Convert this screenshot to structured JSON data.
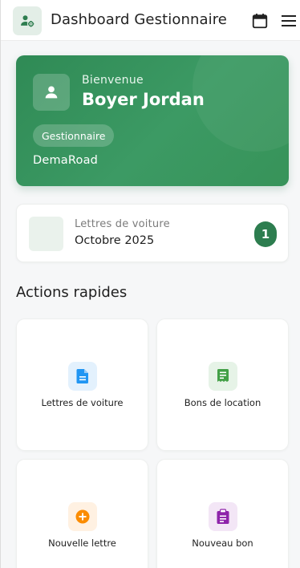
{
  "header": {
    "title": "Dashboard Gestionnaire",
    "brand_icon": "user-gear-icon",
    "calendar_icon": "calendar-icon",
    "menu_icon": "hamburger-menu-icon"
  },
  "welcome": {
    "greeting": "Bienvenue",
    "name": "Boyer Jordan",
    "role": "Gestionnaire",
    "company": "DemaRoad",
    "avatar_icon": "person-icon"
  },
  "summary": {
    "label": "Lettres de voiture",
    "period": "Octobre 2025",
    "count": "1"
  },
  "quick_actions": {
    "title": "Actions rapides",
    "items": [
      {
        "label": "Lettres de voiture",
        "icon": "document-icon",
        "color": "#2196f3",
        "bg": "#e3f1fd"
      },
      {
        "label": "Bons de location",
        "icon": "receipt-icon",
        "color": "#43a047",
        "bg": "#e6f3e7"
      },
      {
        "label": "Nouvelle lettre",
        "icon": "add-circle-icon",
        "color": "#fb8c00",
        "bg": "#fff1e2"
      },
      {
        "label": "Nouveau bon",
        "icon": "clipboard-icon",
        "color": "#8e24aa",
        "bg": "#f3e6f6"
      }
    ]
  },
  "colors": {
    "primary": "#2e7d4f",
    "accent_gradient_start": "#2f8a55",
    "accent_gradient_end": "#379359",
    "background": "#f6f7f8"
  }
}
